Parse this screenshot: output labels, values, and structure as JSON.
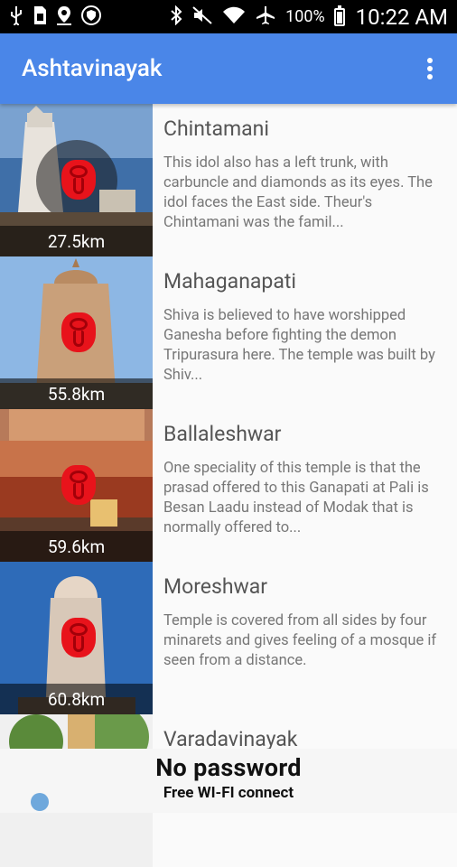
{
  "status_bar": {
    "battery_percent": "100%",
    "time": "10:22 AM",
    "icons": [
      "usb-icon",
      "sim-icon",
      "location-icon",
      "shield-icon",
      "bluetooth-icon",
      "mute-icon",
      "wifi-icon",
      "airplane-icon",
      "battery-icon"
    ]
  },
  "app_bar": {
    "title": "Ashtavinayak",
    "menu_icon": "more-vert-icon"
  },
  "temples": [
    {
      "name": "Chintamani",
      "distance": "27.5km",
      "description": "This idol also has a left trunk, with carbuncle and diamonds as its eyes. The idol faces the East side. Theur's Chintamani was the famil..."
    },
    {
      "name": "Mahaganapati",
      "distance": "55.8km",
      "description": "Shiva is believed to have worshipped Ganesha before fighting the demon Tripurasura here. The temple was built by Shiv..."
    },
    {
      "name": "Ballaleshwar",
      "distance": "59.6km",
      "description": "One speciality of this temple is that the prasad offered to this Ganapati at Pali is Besan Laadu instead of Modak that is normally offered to..."
    },
    {
      "name": "Moreshwar",
      "distance": "60.8km",
      "description": "Temple is covered from all sides by four minarets and gives feeling of a mosque if seen from a distance."
    },
    {
      "name": "Varadavinayak",
      "distance": "",
      "description": ""
    }
  ],
  "ad": {
    "headline": "No password",
    "subline": "Free WI-FI connect"
  },
  "colors": {
    "app_bar": "#4a86e8",
    "status_bar": "#000000",
    "marker": "#e8131b"
  }
}
